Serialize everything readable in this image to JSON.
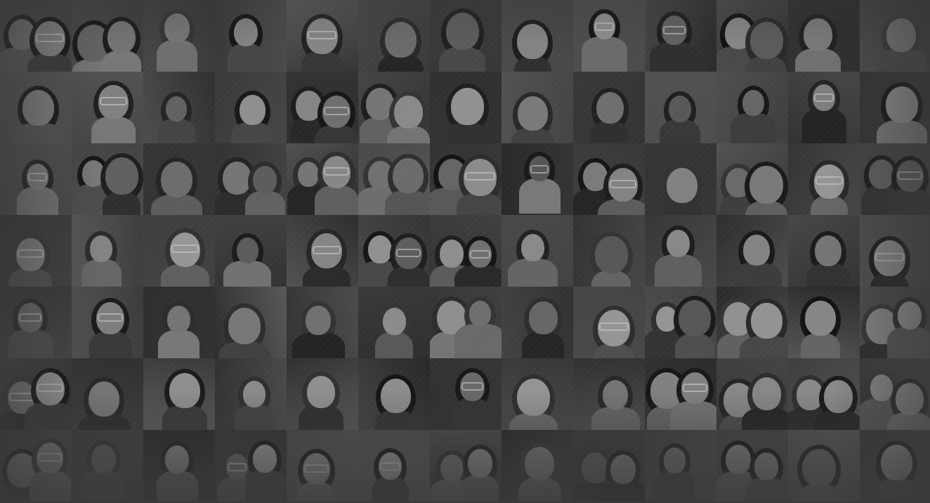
{
  "background": {
    "type": "photo-mosaic",
    "tone": "grayscale",
    "overlay_color": "#38393b",
    "stripe_pattern": "diagonal",
    "tile_columns": 13,
    "tile_rows": 7
  }
}
